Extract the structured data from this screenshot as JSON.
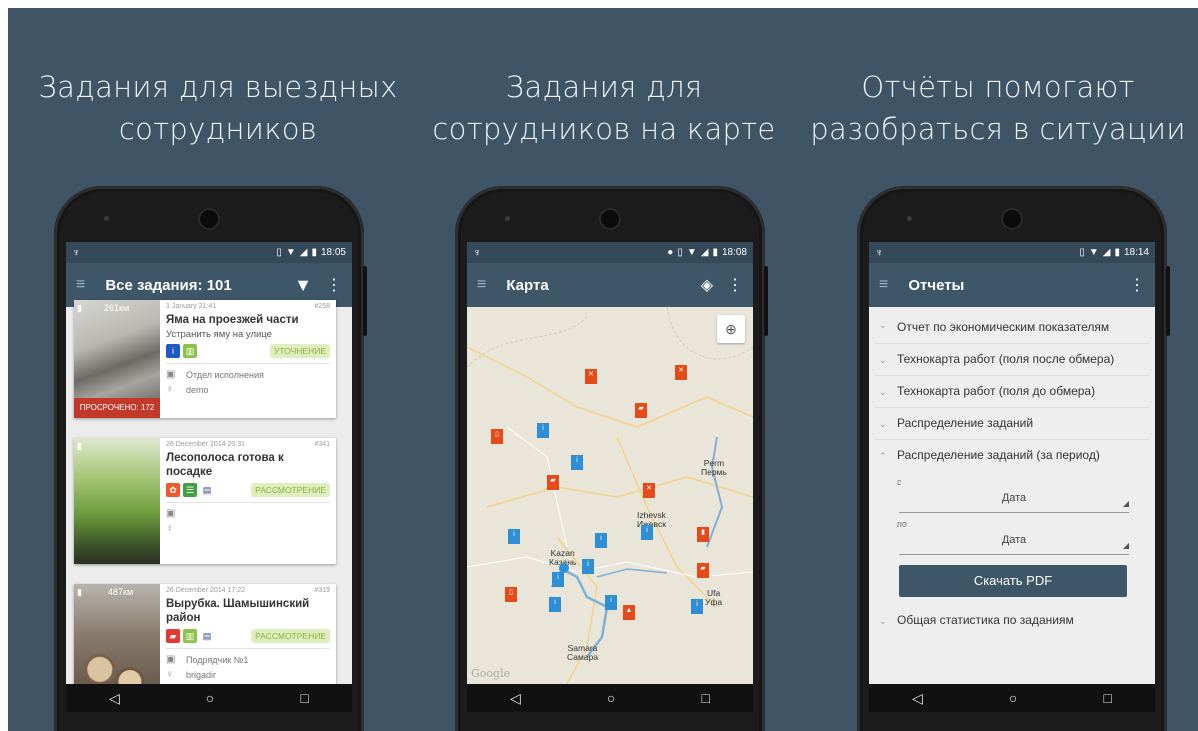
{
  "headlines": [
    "Задания для выездных\nсотрудников",
    "Задания для\nсотрудников на карте",
    "Отчёты помогают\nразобраться в ситуации"
  ],
  "phone1": {
    "time": "18:05",
    "title": "Все задания: 101",
    "cards": [
      {
        "distance": "261км",
        "date": "1 January 21:41",
        "num": "#258",
        "title": "Яма на проезжей части",
        "subtitle": "Устранить яму на улице",
        "status": "УТОЧНЕНИЕ",
        "department": "Отдел исполнения",
        "user": "demo",
        "overdue": "ПРОСРОЧЕНО: 172"
      },
      {
        "distance": "",
        "date": "26 December 2014 20:31",
        "num": "#341",
        "title": "Лесополоса готова к посадке",
        "subtitle": "",
        "status": "РАССМОТРЕНИЕ",
        "department": "",
        "user": ""
      },
      {
        "distance": "487км",
        "date": "26 December 2014 17:22",
        "num": "#319",
        "title": "Вырубка. Шамышинский район",
        "subtitle": "",
        "status": "РАССМОТРЕНИЕ",
        "department": "Подрядчик №1",
        "user": "brigadir"
      }
    ]
  },
  "phone2": {
    "time": "18:08",
    "title": "Карта",
    "cities": [
      {
        "name": "Perm\nПермь"
      },
      {
        "name": "Izhevsk\nИжевск"
      },
      {
        "name": "Kazan\nКазань"
      },
      {
        "name": "Ufa\nУфа"
      },
      {
        "name": "Samara\nСамара"
      }
    ],
    "logo": "Google"
  },
  "phone3": {
    "time": "18:14",
    "title": "Отчеты",
    "reports": [
      "Отчет по экономическим показателям",
      "Технокарта работ (поля после обмера)",
      "Технокарта работ (поля до обмера)",
      "Распределение заданий",
      "Распределение заданий (за период)"
    ],
    "from_label": "с",
    "to_label": "по",
    "date_placeholder": "Дата",
    "download": "Скачать PDF",
    "last_item": "Общая статистика по заданиям"
  },
  "nav": {
    "back": "◁",
    "home": "○",
    "recent": "□"
  },
  "colors": {
    "background": "#3f5566",
    "appbar": "#3d5668",
    "statusbar": "#34495a",
    "accent_green": "#8bb33a",
    "overdue_red": "#c0392b"
  }
}
